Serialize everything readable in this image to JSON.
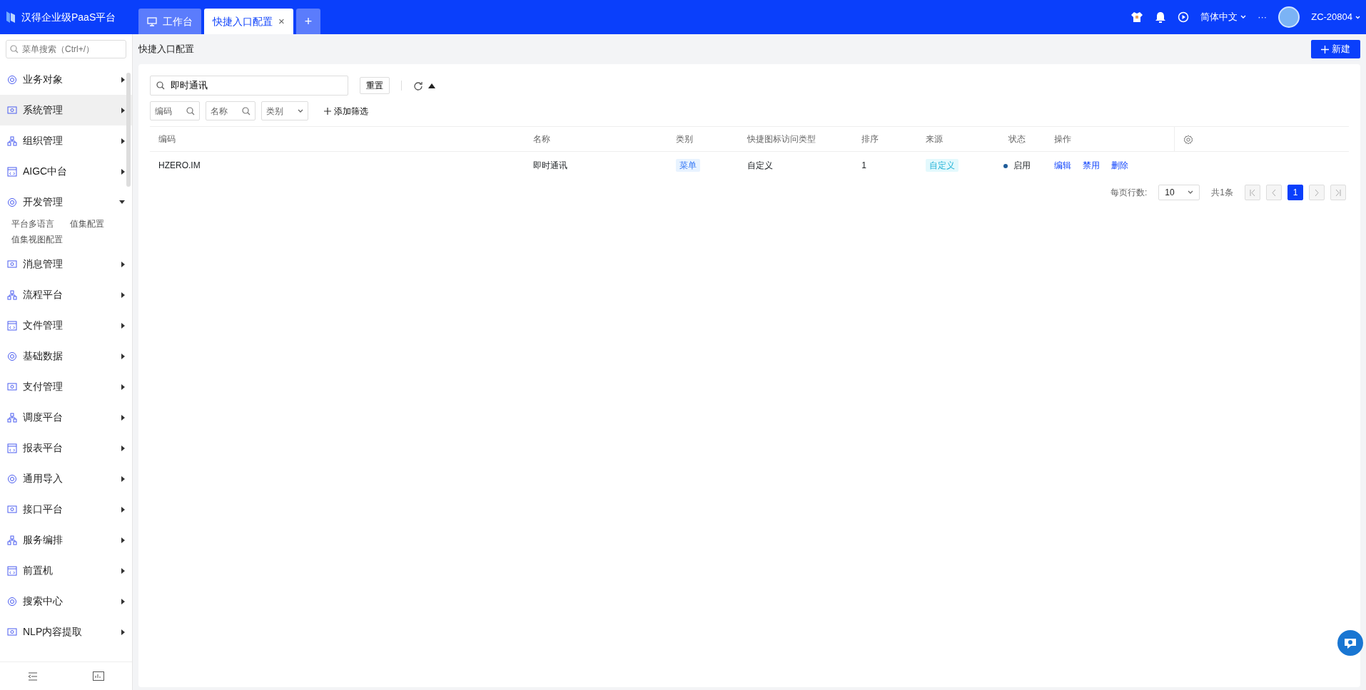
{
  "app": {
    "title": "汉得企业级PaaS平台"
  },
  "tabs": [
    {
      "label": "工作台",
      "selected": false,
      "closable": false
    },
    {
      "label": "快捷入口配置",
      "selected": true,
      "closable": true
    }
  ],
  "tab_close": "×",
  "add_tab": "+",
  "header": {
    "language": "简体中文",
    "more": "···",
    "user": "ZC-20804"
  },
  "sidebar": {
    "search_placeholder": "菜单搜索（Ctrl+/）",
    "items": [
      {
        "label": "业务对象",
        "selected": false,
        "expanded": false
      },
      {
        "label": "系统管理",
        "selected": true,
        "expanded": false
      },
      {
        "label": "组织管理",
        "selected": false,
        "expanded": false
      },
      {
        "label": "AIGC中台",
        "selected": false,
        "expanded": false
      },
      {
        "label": "开发管理",
        "selected": false,
        "expanded": true,
        "children": [
          {
            "label": "平台多语言"
          },
          {
            "label": "值集配置"
          },
          {
            "label": "值集视图配置"
          }
        ]
      },
      {
        "label": "消息管理",
        "selected": false,
        "expanded": false
      },
      {
        "label": "流程平台",
        "selected": false,
        "expanded": false
      },
      {
        "label": "文件管理",
        "selected": false,
        "expanded": false
      },
      {
        "label": "基础数据",
        "selected": false,
        "expanded": false
      },
      {
        "label": "支付管理",
        "selected": false,
        "expanded": false
      },
      {
        "label": "调度平台",
        "selected": false,
        "expanded": false
      },
      {
        "label": "报表平台",
        "selected": false,
        "expanded": false
      },
      {
        "label": "通用导入",
        "selected": false,
        "expanded": false
      },
      {
        "label": "接口平台",
        "selected": false,
        "expanded": false
      },
      {
        "label": "服务编排",
        "selected": false,
        "expanded": false
      },
      {
        "label": "前置机",
        "selected": false,
        "expanded": false
      },
      {
        "label": "搜索中心",
        "selected": false,
        "expanded": false
      },
      {
        "label": "NLP内容提取",
        "selected": false,
        "expanded": false
      }
    ]
  },
  "page": {
    "title": "快捷入口配置",
    "new_button": "新建"
  },
  "filter": {
    "search_value": "即时通讯",
    "reset": "重置",
    "chips": [
      {
        "label": "编码",
        "kind": "search"
      },
      {
        "label": "名称",
        "kind": "search"
      },
      {
        "label": "类别",
        "kind": "select"
      }
    ],
    "add_filter": "添加筛选"
  },
  "table": {
    "columns": [
      "编码",
      "名称",
      "类别",
      "快捷图标访问类型",
      "排序",
      "来源",
      "状态",
      "操作"
    ],
    "rows": [
      {
        "code": "HZERO.IM",
        "name": "即时通讯",
        "type": "菜单",
        "access_type": "自定义",
        "order": "1",
        "source": "自定义",
        "status": {
          "label": "启用",
          "color": "#1f5c99"
        },
        "actions": [
          "编辑",
          "禁用",
          "删除"
        ]
      }
    ]
  },
  "pagination": {
    "rows_per_page_label": "每页行数:",
    "page_size": "10",
    "total": "共1条",
    "pages": [
      {
        "label": "1",
        "selected": true
      }
    ]
  }
}
